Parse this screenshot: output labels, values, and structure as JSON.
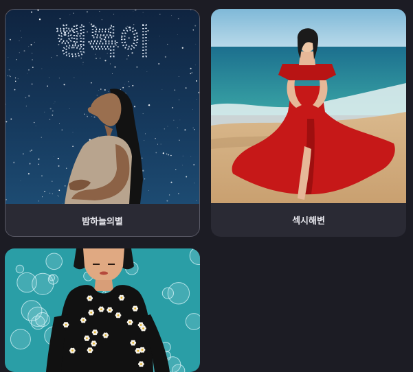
{
  "cards": [
    {
      "caption": "밤하늘의별",
      "image_text": "행복이",
      "selected": true
    },
    {
      "caption": "섹시해변",
      "selected": false
    },
    {
      "caption": "",
      "selected": false
    }
  ]
}
